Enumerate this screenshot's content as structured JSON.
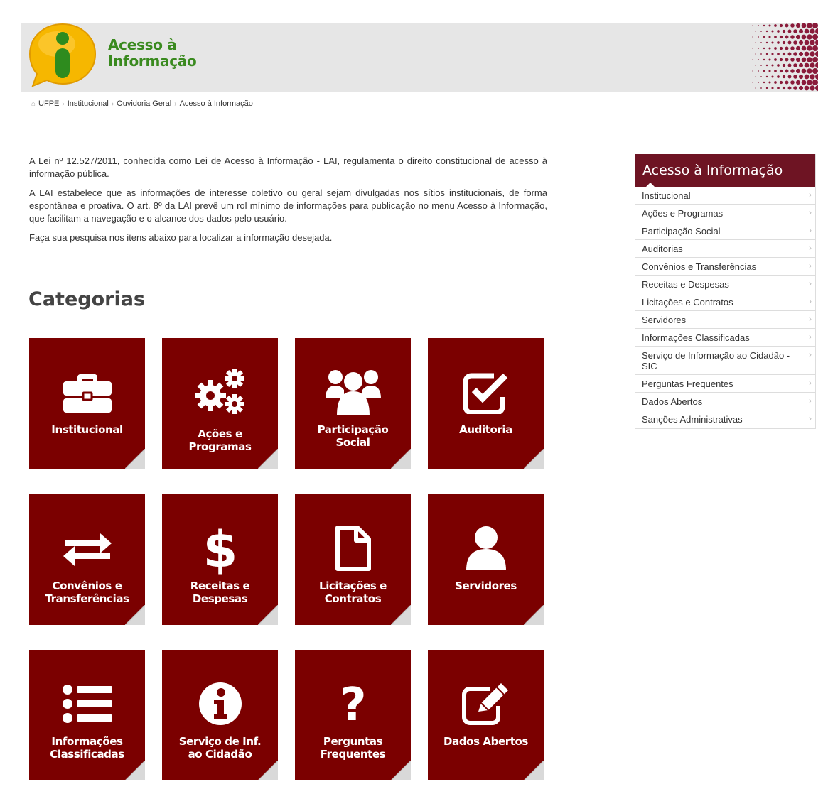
{
  "header": {
    "logo_text_line1": "Acesso à",
    "logo_text_line2": "Informação"
  },
  "breadcrumb": [
    "UFPE",
    "Institucional",
    "Ouvidoria Geral",
    "Acesso à Informação"
  ],
  "intro": [
    "A Lei nº 12.527/2011, conhecida como Lei de Acesso à Informação - LAI, regulamenta o direito constitucional de acesso à informação pública.",
    "A LAI estabelece que as informações de interesse coletivo ou geral sejam divulgadas nos sítios institucionais, de forma espontânea e proativa.  O art. 8º da LAI prevê um rol mínimo de informações para publicação no menu Acesso à Informação, que facilitam a navegação e o alcance dos dados pelo usuário.",
    "Faça sua pesquisa nos itens abaixo para localizar a informação desejada."
  ],
  "categories_title": "Categorias",
  "tiles": [
    {
      "label1": "Institucional",
      "label2": "",
      "icon": "briefcase-icon"
    },
    {
      "label1": "Ações e",
      "label2": "Programas",
      "icon": "gears-icon"
    },
    {
      "label1": "Participação",
      "label2": "Social",
      "icon": "users-icon"
    },
    {
      "label1": "Auditoria",
      "label2": "",
      "icon": "checkbox-icon"
    },
    {
      "label1": "Convênios e",
      "label2": "Transferências",
      "icon": "exchange-icon"
    },
    {
      "label1": "Receitas e",
      "label2": "Despesas",
      "icon": "dollar-icon"
    },
    {
      "label1": "Licitações e",
      "label2": "Contratos",
      "icon": "document-icon"
    },
    {
      "label1": "Servidores",
      "label2": "",
      "icon": "user-icon"
    },
    {
      "label1": "Informações",
      "label2": "Classificadas",
      "icon": "list-icon"
    },
    {
      "label1": "Serviço de Inf.",
      "label2": "ao Cidadão",
      "icon": "info-icon"
    },
    {
      "label1": "Perguntas",
      "label2": "Frequentes",
      "icon": "question-icon"
    },
    {
      "label1": "Dados Abertos",
      "label2": "",
      "icon": "edit-icon"
    }
  ],
  "sidebar": {
    "title": "Acesso à Informação",
    "items": [
      "Institucional",
      "Ações e Programas",
      "Participação Social",
      "Auditorias",
      "Convênios e Transferências",
      "Receitas e Despesas",
      "Licitações e Contratos",
      "Servidores",
      "Informações Classificadas",
      "Serviço de Informação ao Cidadão - SIC",
      "Perguntas Frequentes",
      "Dados Abertos",
      "Sanções Administrativas"
    ]
  },
  "colors": {
    "tile_bg": "#7b0000",
    "sidebar_header": "#6e1423",
    "logo_yellow": "#f6b700",
    "logo_green": "#3a8a1f"
  }
}
